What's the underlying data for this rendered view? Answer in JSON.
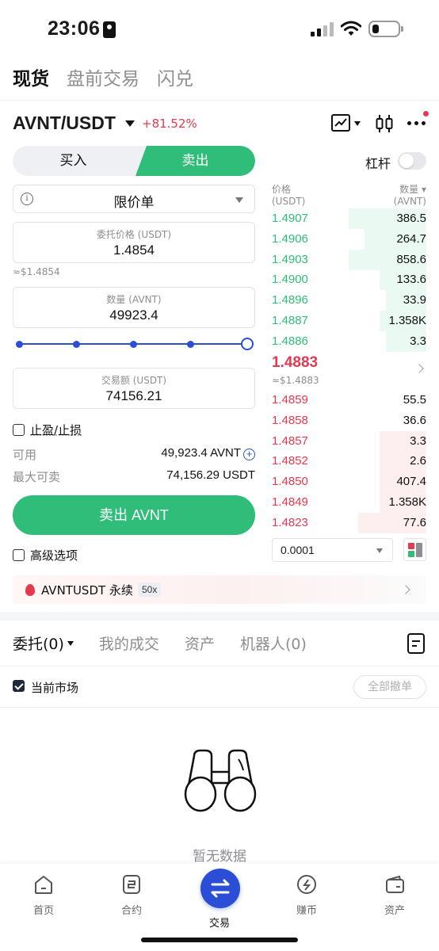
{
  "status": {
    "time": "23:06"
  },
  "top_tabs": [
    "现货",
    "盘前交易",
    "闪兑"
  ],
  "pair": {
    "name": "AVNT/USDT",
    "change": "+81.52%"
  },
  "side": {
    "buy": "买入",
    "sell": "卖出"
  },
  "leverage": {
    "label": "杠杆",
    "enabled": false
  },
  "order_form": {
    "order_type": "限价单",
    "price_label": "委托价格 (USDT)",
    "price_value": "1.4854",
    "price_approx": "≈$1.4854",
    "qty_label": "数量 (AVNT)",
    "qty_value": "49923.4",
    "slider_percent": 100,
    "total_label": "交易额 (USDT)",
    "total_value": "74156.21",
    "tp_sl_label": "止盈/止损",
    "available_label": "可用",
    "available_value": "49,923.4 AVNT",
    "max_sell_label": "最大可卖",
    "max_sell_value": "74,156.29 USDT",
    "submit_label": "卖出 AVNT",
    "advanced_label": "高级选项"
  },
  "order_book": {
    "price_header": "价格\n(USDT)",
    "price_header_1": "价格",
    "price_header_2": "(USDT)",
    "qty_header_1": "数量 ▾",
    "qty_header_2": "(AVNT)",
    "bids": [
      {
        "price": "1.4907",
        "qty": "386.5",
        "depth": 0.5
      },
      {
        "price": "1.4906",
        "qty": "264.7",
        "depth": 0.4
      },
      {
        "price": "1.4903",
        "qty": "858.6",
        "depth": 0.5
      },
      {
        "price": "1.4900",
        "qty": "133.6",
        "depth": 0.3
      },
      {
        "price": "1.4896",
        "qty": "33.9",
        "depth": 0.26
      },
      {
        "price": "1.4887",
        "qty": "1.358K",
        "depth": 0.3
      },
      {
        "price": "1.4886",
        "qty": "3.3",
        "depth": 0.26
      }
    ],
    "mid_price": "1.4883",
    "mid_approx": "≈$1.4883",
    "asks": [
      {
        "price": "1.4859",
        "qty": "55.5",
        "depth": 0.0
      },
      {
        "price": "1.4858",
        "qty": "36.6",
        "depth": 0.0
      },
      {
        "price": "1.4857",
        "qty": "3.3",
        "depth": 0.3
      },
      {
        "price": "1.4852",
        "qty": "2.6",
        "depth": 0.3
      },
      {
        "price": "1.4850",
        "qty": "407.4",
        "depth": 0.3
      },
      {
        "price": "1.4849",
        "qty": "1.358K",
        "depth": 0.3
      },
      {
        "price": "1.4823",
        "qty": "77.6",
        "depth": 0.44
      }
    ],
    "precision": "0.0001"
  },
  "perp_banner": {
    "name": "AVNTUSDT 永续",
    "leverage": "50x"
  },
  "orders_section": {
    "tabs": [
      "委托(0)",
      "我的成交",
      "资产",
      "机器人(0)"
    ],
    "current_market_label": "当前市场",
    "cancel_all": "全部撤单",
    "empty_text": "暂无数据"
  },
  "tab_bar": [
    {
      "label": "首页",
      "icon": "home-icon"
    },
    {
      "label": "合约",
      "icon": "contract-icon"
    },
    {
      "label": "交易",
      "icon": "trade-icon"
    },
    {
      "label": "赚币",
      "icon": "earn-icon"
    },
    {
      "label": "资产",
      "icon": "wallet-icon"
    }
  ],
  "colors": {
    "green": "#2fbd79",
    "red": "#e4394f",
    "blue": "#2a4fd6"
  }
}
